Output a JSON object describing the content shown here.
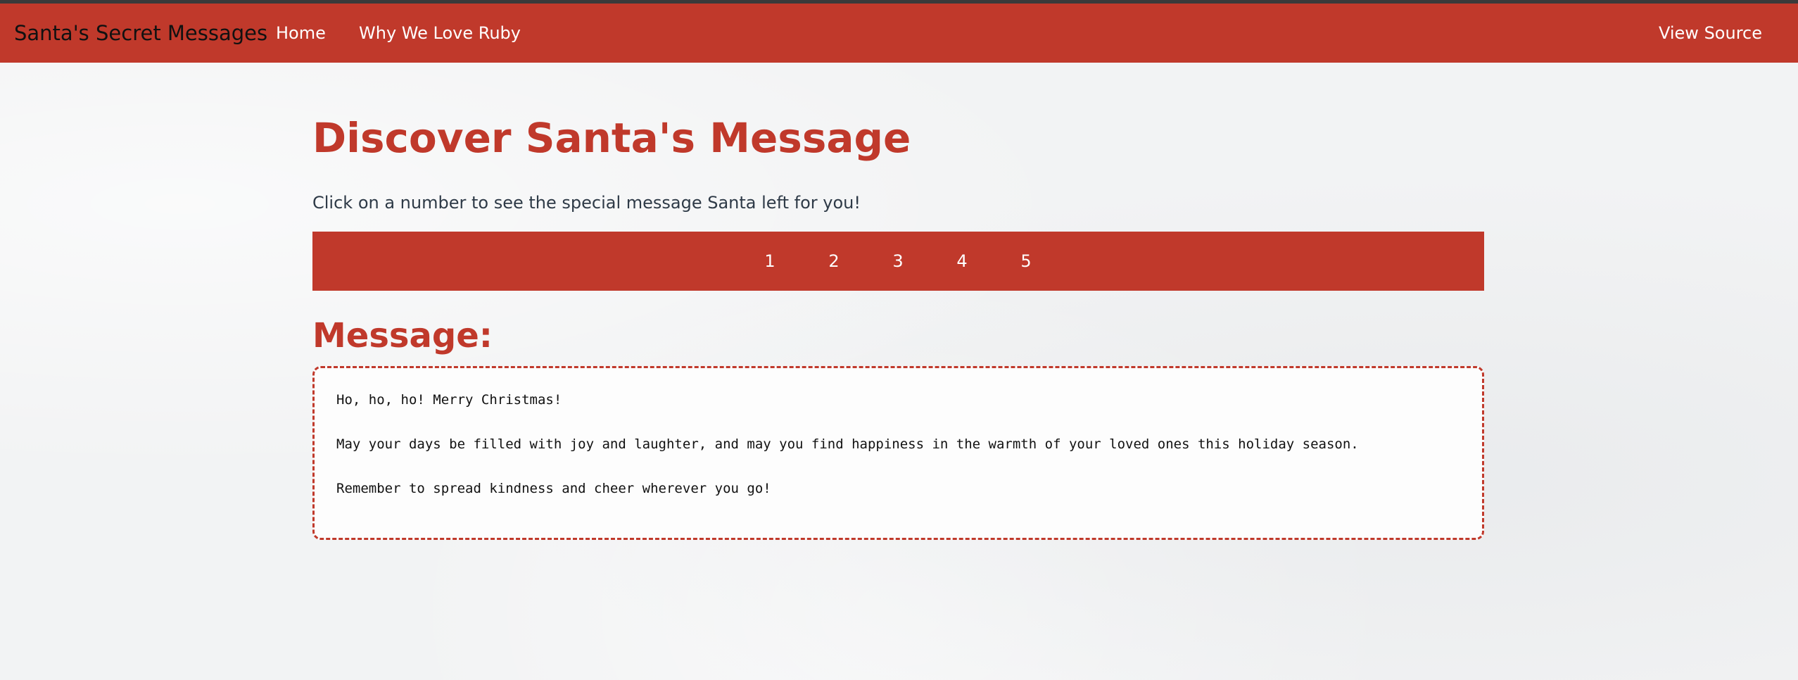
{
  "navbar": {
    "brand": "Santa's Secret Messages",
    "links": [
      "Home",
      "Why We Love Ruby"
    ],
    "view_source": "View Source",
    "color": "#c0392b"
  },
  "main": {
    "title": "Discover Santa's Message",
    "subtitle": "Click on a number to see the special message Santa left for you!",
    "numbers": [
      "1",
      "2",
      "3",
      "4",
      "5"
    ],
    "message_heading": "Message:",
    "message_lines": [
      "Ho, ho, ho! Merry Christmas!",
      "May your days be filled with joy and laughter, and may you find happiness in the warmth of your loved ones this holiday season.",
      "Remember to spread kindness and cheer wherever you go!"
    ]
  },
  "colors": {
    "accent": "#c0392b",
    "background": "#f2f3f4",
    "top_border": "#3a3a3a"
  }
}
